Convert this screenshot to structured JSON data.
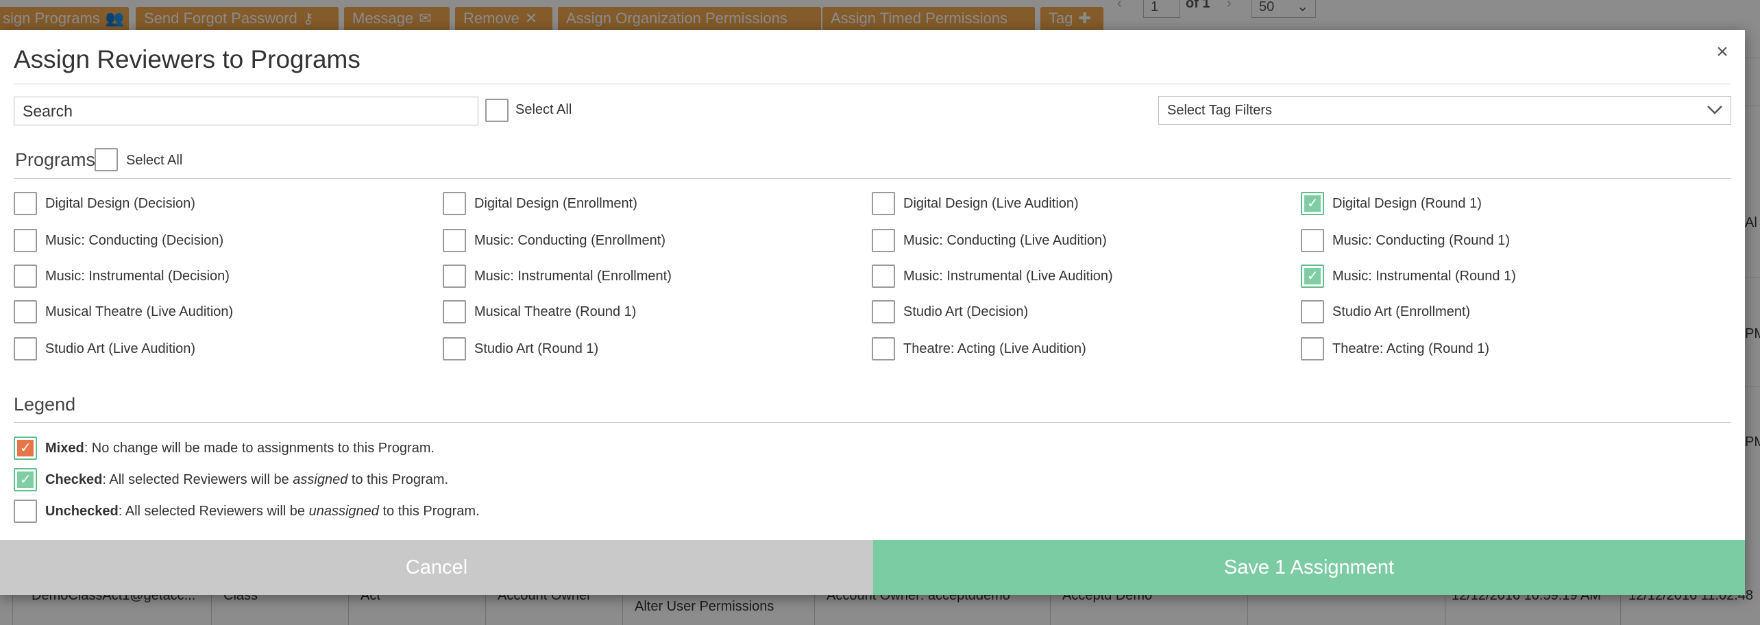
{
  "background": {
    "toolbar_buttons": [
      {
        "label": "sign Programs",
        "icon": "users-icon"
      },
      {
        "label": "Send Forgot Password",
        "icon": "key-icon"
      },
      {
        "label": "Message",
        "icon": "envelope-icon"
      },
      {
        "label": "Remove",
        "icon": "x-icon"
      },
      {
        "label": "Assign Organization Permissions",
        "icon": ""
      },
      {
        "label": "Assign Timed Permissions",
        "icon": ""
      },
      {
        "label": "Tag",
        "icon": "plus-icon"
      }
    ],
    "pager": {
      "page": "1",
      "of_label": "of 1",
      "page_size": "50"
    },
    "row": {
      "email": "DemoClassAct1@getacc...",
      "type": "Class",
      "act": "Act",
      "role": "Account Owner",
      "permissions": "Alter User Permissions",
      "account_owner": "Account Owner: acceptddemo",
      "org": "Acceptd Demo",
      "created": "12/12/2016 10:59:19 AM",
      "updated": "12/12/2016 11:02:48"
    },
    "side_snippets": [
      "Al",
      "PM",
      "PM"
    ]
  },
  "modal": {
    "title": "Assign Reviewers to Programs",
    "close_label": "×",
    "search": {
      "placeholder": "Search",
      "value": ""
    },
    "select_all_label": "Select All",
    "tag_filter_label": "Select Tag Filters",
    "programs_heading": "Programs",
    "programs_select_all_label": "Select All",
    "programs": [
      {
        "label": "Digital Design (Decision)",
        "checked": false
      },
      {
        "label": "Digital Design (Enrollment)",
        "checked": false
      },
      {
        "label": "Digital Design (Live Audition)",
        "checked": false
      },
      {
        "label": "Digital Design (Round 1)",
        "checked": true
      },
      {
        "label": "Music: Conducting (Decision)",
        "checked": false
      },
      {
        "label": "Music: Conducting (Enrollment)",
        "checked": false
      },
      {
        "label": "Music: Conducting (Live Audition)",
        "checked": false
      },
      {
        "label": "Music: Conducting (Round 1)",
        "checked": false
      },
      {
        "label": "Music: Instrumental (Decision)",
        "checked": false
      },
      {
        "label": "Music: Instrumental (Enrollment)",
        "checked": false
      },
      {
        "label": "Music: Instrumental (Live Audition)",
        "checked": false
      },
      {
        "label": "Music: Instrumental (Round 1)",
        "checked": true
      },
      {
        "label": "Musical Theatre (Live Audition)",
        "checked": false
      },
      {
        "label": "Musical Theatre (Round 1)",
        "checked": false
      },
      {
        "label": "Studio Art (Decision)",
        "checked": false
      },
      {
        "label": "Studio Art (Enrollment)",
        "checked": false
      },
      {
        "label": "Studio Art (Live Audition)",
        "checked": false
      },
      {
        "label": "Studio Art (Round 1)",
        "checked": false
      },
      {
        "label": "Theatre: Acting (Live Audition)",
        "checked": false
      },
      {
        "label": "Theatre: Acting (Round 1)",
        "checked": false
      }
    ],
    "legend": {
      "heading": "Legend",
      "mixed": {
        "term": "Mixed",
        "text": ": No change will be made to assignments to this Program."
      },
      "checked": {
        "term": "Checked",
        "text_before": ": All selected Reviewers will be ",
        "emphasis": "assigned",
        "text_after": " to this Program."
      },
      "unchecked": {
        "term": "Unchecked",
        "text_before": ": All selected Reviewers will be ",
        "emphasis": "unassigned",
        "text_after": " to this Program."
      }
    },
    "footer": {
      "cancel_label": "Cancel",
      "save_label": "Save 1 Assignment"
    }
  },
  "colors": {
    "accent_orange": "#f0a64d",
    "checked_green": "#7fcda3",
    "mixed_orange": "#e8744a",
    "save_green": "#7bcca3",
    "cancel_gray": "#c9c9c9"
  }
}
